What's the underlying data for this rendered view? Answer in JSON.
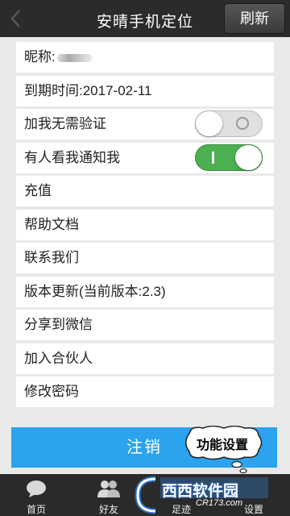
{
  "header": {
    "title": "安晴手机定位",
    "refresh_label": "刷新"
  },
  "settings": {
    "nickname_label": "昵称:",
    "expiry": "到期时间:2017-02-11",
    "no_verify": {
      "label": "加我无需验证",
      "state": "off"
    },
    "notify": {
      "label": "有人看我通知我",
      "state": "on"
    },
    "recharge": "充值",
    "help": "帮助文档",
    "contact": "联系我们",
    "update": "版本更新(当前版本:2.3)",
    "share": "分享到微信",
    "partner": "加入合伙人",
    "change_password": "修改密码"
  },
  "logout_label": "注销",
  "annotation_bubble": "功能设置",
  "tabs": [
    {
      "label": "首页",
      "icon": "chat-bubble-icon"
    },
    {
      "label": "好友",
      "icon": "friends-icon"
    },
    {
      "label": "足迹",
      "icon": "footprint-icon"
    },
    {
      "label": "设置",
      "icon": "settings-icon"
    }
  ],
  "watermark": {
    "brand": "西西软件园",
    "site": "CR173.com"
  }
}
